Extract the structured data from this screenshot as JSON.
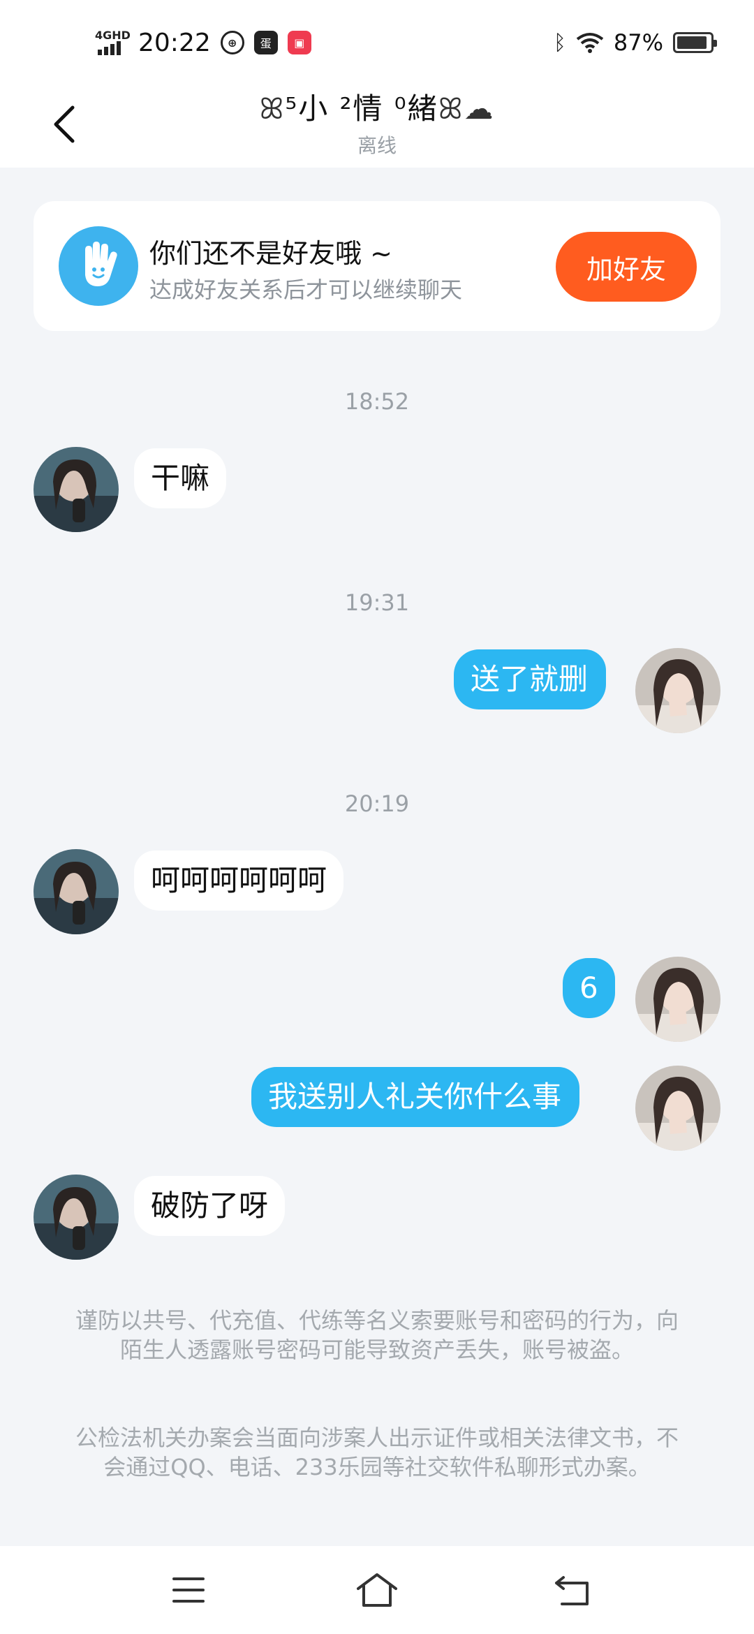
{
  "status_bar": {
    "network": "4GHD",
    "time": "20:22",
    "app_icon_1": "蛋",
    "battery": "87%"
  },
  "header": {
    "title_text": "⁵小 ²情 ⁰緒",
    "status": "离线"
  },
  "friend_banner": {
    "title": "你们还不是好友哦 ~",
    "description": "达成好友关系后才可以继续聊天",
    "button": "加好友",
    "accent": "#ff5c1f"
  },
  "messages": [
    {
      "type": "time",
      "text": "18:52"
    },
    {
      "type": "msg",
      "side": "left",
      "text": "干嘛"
    },
    {
      "type": "time",
      "text": "19:31"
    },
    {
      "type": "msg",
      "side": "right",
      "text": "送了就删"
    },
    {
      "type": "time",
      "text": "20:19"
    },
    {
      "type": "msg",
      "side": "left",
      "text": "呵呵呵呵呵呵"
    },
    {
      "type": "msg",
      "side": "right",
      "text": "6"
    },
    {
      "type": "msg",
      "side": "right",
      "text": "我送别人礼关你什么事"
    },
    {
      "type": "msg",
      "side": "left",
      "text": "破防了呀"
    }
  ],
  "notices": [
    "谨防以共号、代充值、代练等名义索要账号和密码的行为，向陌生人透露账号密码可能导致资产丢失，账号被盗。",
    "公检法机关办案会当面向涉案人出示证件或相关法律文书，不会通过QQ、电话、233乐园等社交软件私聊形式办案。"
  ],
  "colors": {
    "bubble_right": "#2cb7f2",
    "bubble_left": "#ffffff",
    "background": "#f3f5f8"
  },
  "icons": {
    "back": "chevron-left-icon",
    "friend": "waving-hand-icon",
    "menu": "menu-icon",
    "home": "home-icon",
    "return": "return-icon"
  }
}
